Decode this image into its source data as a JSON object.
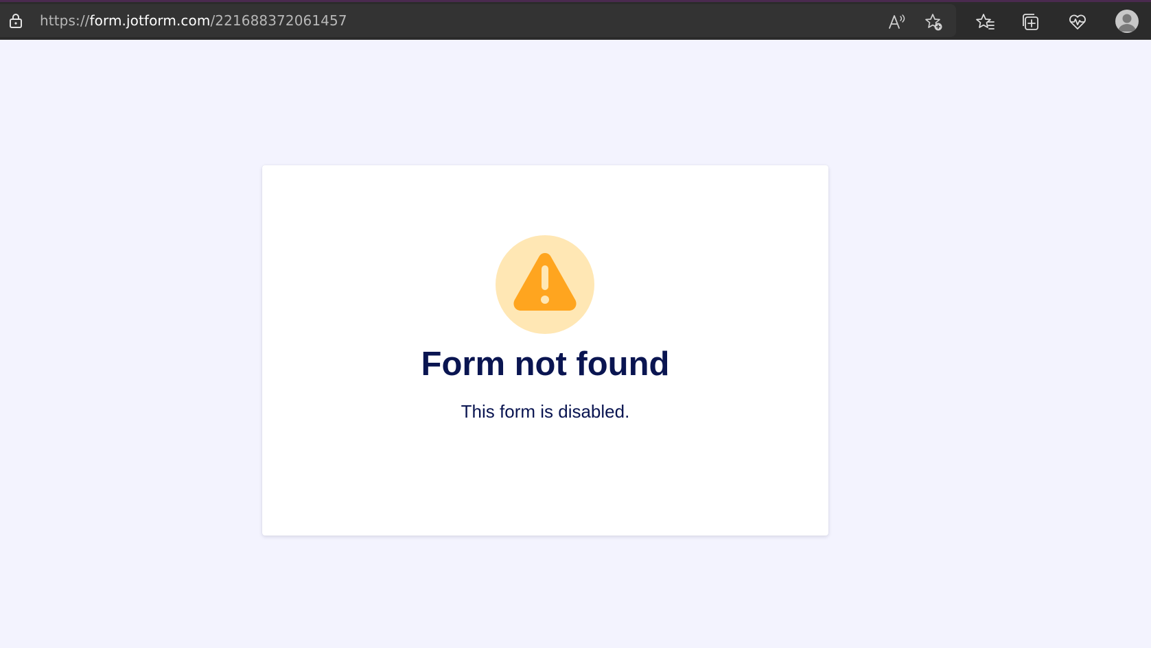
{
  "browser": {
    "url_scheme": "https://",
    "url_host": "form.jotform.com",
    "url_path": "/221688372061457",
    "toolbar_icons": [
      "read-aloud-icon",
      "add-favorite-icon",
      "favorites-icon",
      "collections-icon",
      "browser-essentials-icon",
      "profile-icon"
    ]
  },
  "page": {
    "title": "Form not found",
    "message": "This form is disabled.",
    "icon": "warning-icon",
    "colors": {
      "background": "#f3f3fe",
      "card": "#ffffff",
      "text": "#0a1551",
      "icon_circle": "#ffe7b4",
      "icon_triangle": "#ffa51f"
    }
  }
}
